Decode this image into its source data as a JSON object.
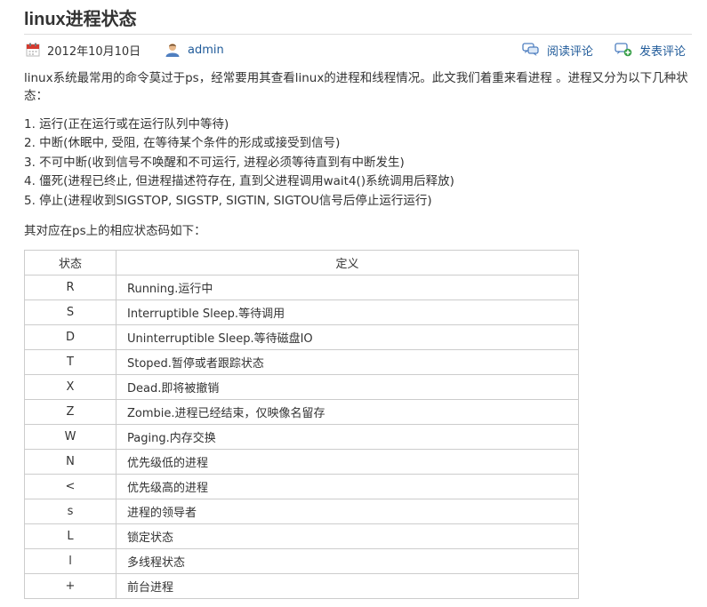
{
  "article": {
    "title": "linux进程状态",
    "meta": {
      "date": "2012年10月10日",
      "author": "admin",
      "read_comments": "阅读评论",
      "post_comment": "发表评论"
    },
    "intro": "linux系统最常用的命令莫过于ps，经常要用其查看linux的进程和线程情况。此文我们着重来看进程 。进程又分为以下几种状态：",
    "states": [
      "1. 运行(正在运行或在运行队列中等待)",
      "2. 中断(休眠中, 受阻, 在等待某个条件的形成或接受到信号)",
      "3. 不可中断(收到信号不唤醒和不可运行, 进程必须等待直到有中断发生)",
      "4. 僵死(进程已终止, 但进程描述符存在, 直到父进程调用wait4()系统调用后释放)",
      "5. 停止(进程收到SIGSTOP, SIGSTP, SIGTIN, SIGTOU信号后停止运行运行)"
    ],
    "table_intro": "其对应在ps上的相应状态码如下：",
    "table": {
      "headers": [
        "状态",
        "定义"
      ],
      "rows": [
        [
          "R",
          "Running.运行中"
        ],
        [
          "S",
          "Interruptible Sleep.等待调用"
        ],
        [
          "D",
          "Uninterruptible Sleep.等待磁盘IO"
        ],
        [
          "T",
          "Stoped.暂停或者跟踪状态"
        ],
        [
          "X",
          "Dead.即将被撤销"
        ],
        [
          "Z",
          "Zombie.进程已经结束，仅映像名留存"
        ],
        [
          "W",
          "Paging.内存交换"
        ],
        [
          "N",
          "优先级低的进程"
        ],
        [
          "<",
          "优先级高的进程"
        ],
        [
          "s",
          "进程的领导者"
        ],
        [
          "L",
          "锁定状态"
        ],
        [
          "l",
          "多线程状态"
        ],
        [
          "+",
          "前台进程"
        ]
      ]
    }
  },
  "icons": {
    "date": "calendar-icon",
    "author": "user-icon",
    "read_comments": "comments-icon",
    "post_comment": "add-comment-icon"
  },
  "colors": {
    "link": "#1f5a99",
    "text": "#333333",
    "border": "#cccccc",
    "calendar_red": "#d43a2f",
    "user_blue": "#4f7fc0"
  }
}
